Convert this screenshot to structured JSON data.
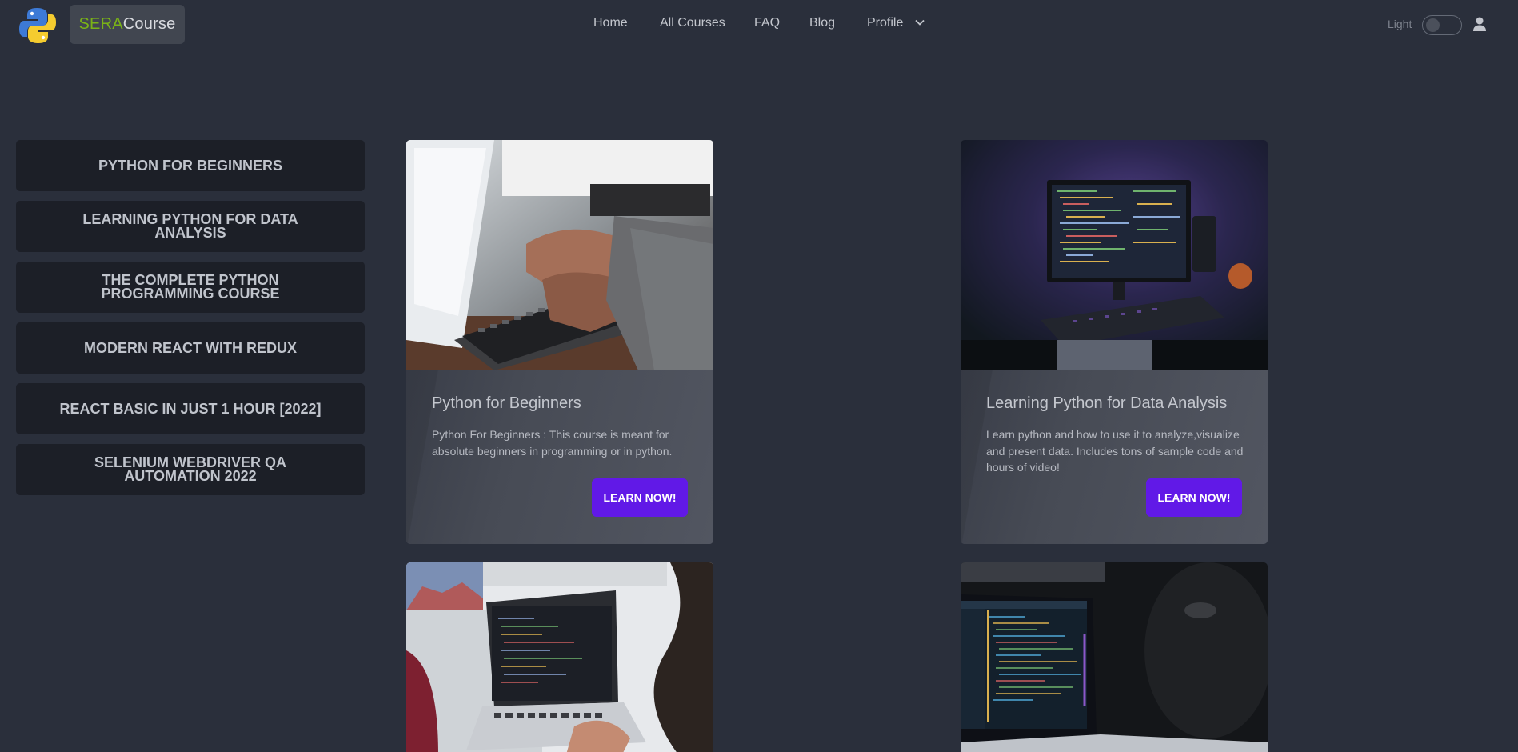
{
  "brand": {
    "part1": "SERA",
    "part2": "Course",
    "logo_icon": "python-logo-icon"
  },
  "nav": {
    "home": "Home",
    "all_courses": "All Courses",
    "faq": "FAQ",
    "blog": "Blog",
    "profile": "Profile"
  },
  "theme": {
    "label": "Light",
    "enabled": false
  },
  "sidebar": {
    "items": [
      {
        "label": "PYTHON FOR BEGINNERS"
      },
      {
        "label": "LEARNING PYTHON FOR DATA ANALYSIS"
      },
      {
        "label": "THE COMPLETE PYTHON PROGRAMMING COURSE"
      },
      {
        "label": "MODERN REACT WITH REDUX"
      },
      {
        "label": "REACT BASIC IN JUST 1 HOUR [2022]"
      },
      {
        "label": "SELENIUM WEBDRIVER QA AUTOMATION 2022"
      }
    ]
  },
  "cards": [
    {
      "title": "Python for Beginners",
      "description": "Python For Beginners : This course is meant for absolute beginners in programming or in python.",
      "button": "LEARN NOW!"
    },
    {
      "title": "Learning Python for Data Analysis",
      "description": "Learn python and how to use it to analyze,visualize and present data. Includes tons of sample code and hours of video!",
      "button": "LEARN NOW!"
    }
  ],
  "colors": {
    "background": "#2a2f3b",
    "accent": "#6119e7",
    "brand_green": "#7ab317",
    "sidebar_item": "#1c1f27"
  }
}
